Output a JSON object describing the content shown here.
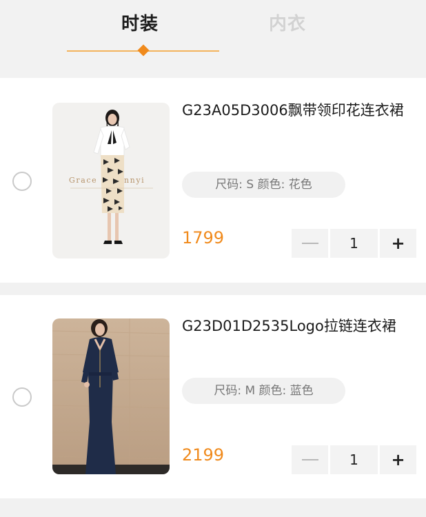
{
  "tabs": [
    {
      "label": "时装",
      "active": true
    },
    {
      "label": "内衣",
      "active": false
    }
  ],
  "colors": {
    "accent": "#f08a1c",
    "underline": "#f3b35c",
    "price": "#f08a1c"
  },
  "items": [
    {
      "title": "G23A05D3006飘带领印花连衣裙",
      "spec": "尺码: S 颜色: 花色",
      "price": "1799",
      "quantity": "1",
      "selected": false,
      "image_brand_text": "Grace Kennyi"
    },
    {
      "title": "G23D01D2535Logo拉链连衣裙",
      "spec": "尺码: M 颜色: 蓝色",
      "price": "2199",
      "quantity": "1",
      "selected": false
    }
  ],
  "icons": {
    "minus": "minus-icon",
    "plus": "plus-icon",
    "select": "radio-circle"
  }
}
